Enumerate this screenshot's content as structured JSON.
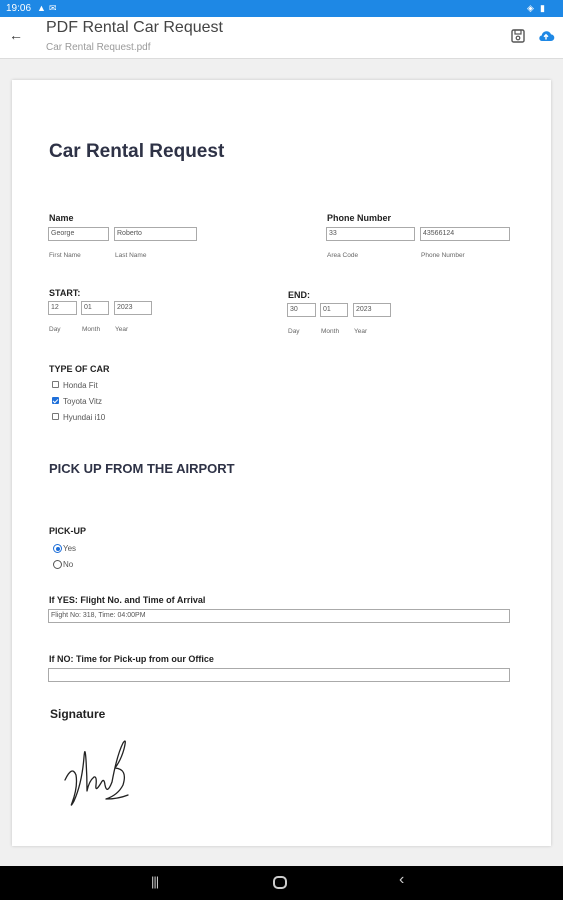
{
  "status": {
    "time": "19:06"
  },
  "appbar": {
    "title": "PDF Rental Car Request",
    "subtitle": "Car Rental Request.pdf"
  },
  "icons": {
    "back": "arrow-left-icon",
    "save": "save-icon",
    "upload": "cloud-upload-icon",
    "accent": "#1e88e5"
  },
  "form": {
    "title": "Car Rental Request",
    "name": {
      "label": "Name",
      "first": "George",
      "last": "Roberto",
      "first_sub": "First Name",
      "last_sub": "Last Name"
    },
    "phone": {
      "label": "Phone Number",
      "area": "33",
      "number": "43566124",
      "area_sub": "Area Code",
      "number_sub": "Phone Number"
    },
    "start": {
      "label": "START:",
      "day": "12",
      "month": "01",
      "year": "2023",
      "day_sub": "Day",
      "month_sub": "Month",
      "year_sub": "Year"
    },
    "end": {
      "label": "END:",
      "day": "30",
      "month": "01",
      "year": "2023",
      "day_sub": "Day",
      "month_sub": "Month",
      "year_sub": "Year"
    },
    "car_type": {
      "label": "TYPE OF CAR",
      "options": [
        {
          "label": "Honda Fit",
          "checked": false
        },
        {
          "label": "Toyota Vitz",
          "checked": true
        },
        {
          "label": "Hyundai i10",
          "checked": false
        }
      ]
    },
    "section": "PICK UP FROM THE AIRPORT",
    "pickup": {
      "label": "PICK-UP",
      "yes": "Yes",
      "no": "No",
      "selected": "Yes"
    },
    "flight": {
      "label": "If YES: Flight No. and Time of Arrival",
      "value": "Flight No: 318, Time: 04:00PM"
    },
    "office": {
      "label": "If NO: Time for Pick-up from our Office",
      "value": ""
    },
    "signature": {
      "label": "Signature"
    }
  }
}
